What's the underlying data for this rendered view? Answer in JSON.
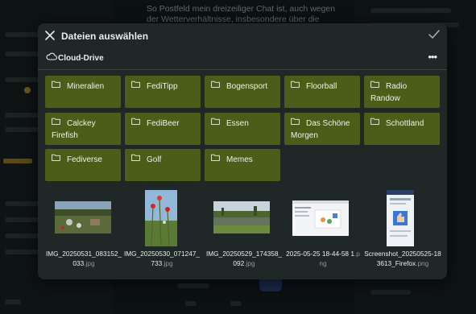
{
  "background": {
    "text": "So Postfeld mein dreizeiliger Chat ist, auch wegen der Wetterverhältnisse, insbesondere über die Grenze nach"
  },
  "dialog": {
    "title": "Dateien auswählen",
    "confirm_icon": "check-icon",
    "close_icon": "close-icon",
    "path_label": "Cloud-Drive",
    "more_label": "•••"
  },
  "folders": [
    {
      "name": "Mineralien"
    },
    {
      "name": "FediTipp"
    },
    {
      "name": "Bogensport"
    },
    {
      "name": "Floorball"
    },
    {
      "name": "Radio Randow"
    },
    {
      "name": "Calckey Firefish"
    },
    {
      "name": "FediBeer"
    },
    {
      "name": "Essen"
    },
    {
      "name": "Das Schöne Morgen"
    },
    {
      "name": "Schottland"
    },
    {
      "name": "Fediverse"
    },
    {
      "name": "Golf"
    },
    {
      "name": "Memes"
    }
  ],
  "files": [
    {
      "base": "IMG_20250531_083152_033",
      "ext": ".jpg"
    },
    {
      "base": "IMG_20250530_071247_733",
      "ext": ".jpg"
    },
    {
      "base": "IMG_20250529_174358_092",
      "ext": ".jpg"
    },
    {
      "base": "2025-05-25 18-44-58 1",
      "ext": ".png"
    },
    {
      "base": "Screenshot_20250525-183613_Firefox",
      "ext": ".png"
    }
  ],
  "colors": {
    "folder_bg": "#4a5e19",
    "dialog_bg": "#1f2727"
  }
}
